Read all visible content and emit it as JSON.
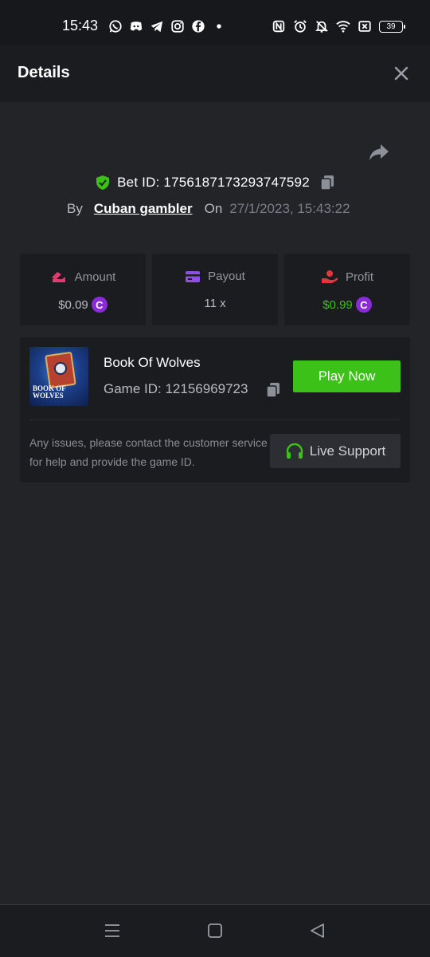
{
  "status_bar": {
    "time": "15:43",
    "battery": "39",
    "left_icons": [
      "whatsapp-icon",
      "discord-icon",
      "telegram-icon",
      "instagram-icon",
      "facebook-icon",
      "dot-icon"
    ],
    "right_icons": [
      "nfc-icon",
      "alarm-icon",
      "mute-icon",
      "wifi-icon",
      "close-box-icon",
      "battery-icon"
    ]
  },
  "header": {
    "title": "Details",
    "close_icon": "close-icon"
  },
  "bet": {
    "bet_id_text": "Bet ID: 1756187173293747592",
    "by_label": "By",
    "user": "Cuban gambler",
    "on_label": "On",
    "date": "27/1/2023, 15:43:22"
  },
  "stats": {
    "amount": {
      "label": "Amount",
      "value": "$0.09",
      "color": "#b8bbc2",
      "icon": "amount-icon",
      "icon_color": "#e23a6e"
    },
    "payout": {
      "label": "Payout",
      "value": "11 x",
      "color": "#b8bbc2",
      "icon": "card-icon",
      "icon_color": "#8e4ee8"
    },
    "profit": {
      "label": "Profit",
      "value": "$0.99",
      "color": "#3bc117",
      "icon": "profit-icon",
      "icon_color": "#e0383a"
    },
    "coin_symbol": "C"
  },
  "game": {
    "name": "Book Of Wolves",
    "game_id_text": "Game ID: 12156969723",
    "thumb_text": "BOOK OF WOLVES",
    "play_label": "Play Now",
    "play_color": "#3bc117",
    "support_text": "Any issues, please contact the customer service for help and provide the game ID.",
    "support_label": "Live Support",
    "support_icon_color": "#3bc117"
  },
  "nav": {
    "icons": [
      "menu-icon",
      "home-icon",
      "back-icon"
    ]
  }
}
